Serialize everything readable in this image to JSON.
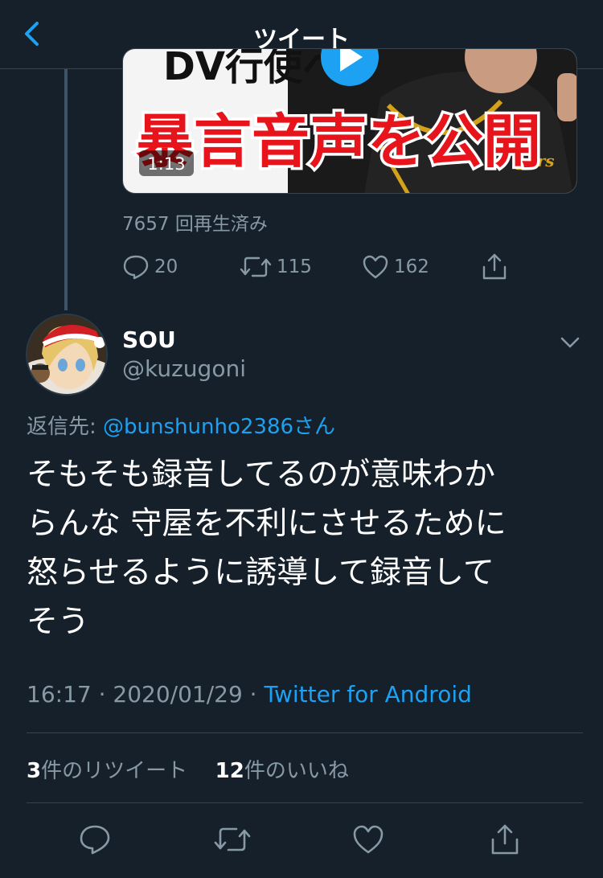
{
  "nav": {
    "title": "ツイート",
    "back_icon": "chevron-left-icon"
  },
  "colors": {
    "background": "#15202b",
    "accent": "#1da1f2",
    "secondary_text": "#8899a6",
    "divider": "#38444d"
  },
  "quoted_tweet": {
    "video": {
      "overlay_text": "暴言音声を公開",
      "top_text": "DV行使への",
      "duration": "1:13",
      "jersey_text": "gers"
    },
    "views": "7657 回再生済み",
    "actions": {
      "reply_count": "20",
      "retweet_count": "115",
      "like_count": "162"
    }
  },
  "tweet": {
    "display_name": "SOU",
    "handle": "@kuzugoni",
    "reply_to_prefix": "返信先: ",
    "reply_to_mention": "@bunshunho2386さん",
    "text": "そもそも録音してるのが意味わか\nらんな 守屋を不利にさせるために\n怒らせるように誘導して録音して\nそう",
    "time_date": "16:17 · 2020/01/29 · ",
    "source": "Twitter for Android",
    "retweets_num": "3",
    "retweets_label": "件のリツイート",
    "likes_num": "12",
    "likes_label": "件のいいね"
  }
}
